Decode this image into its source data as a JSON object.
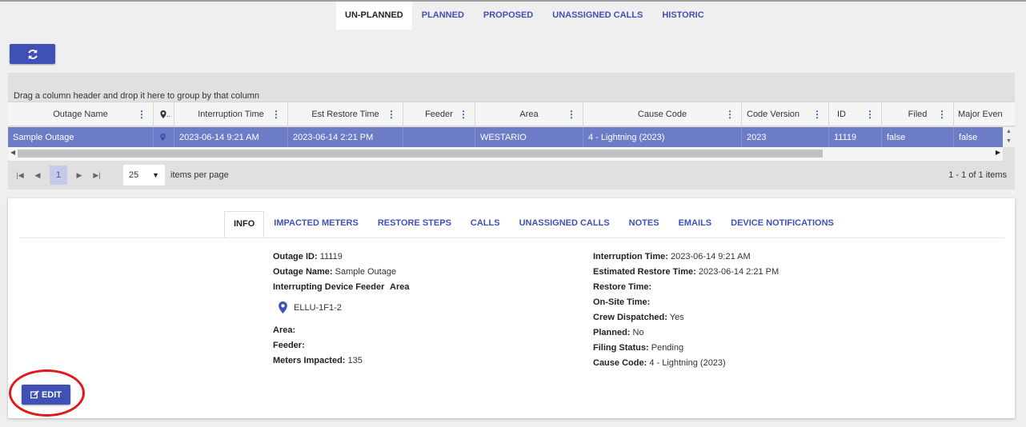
{
  "top_tabs": [
    "UN-PLANNED",
    "PLANNED",
    "PROPOSED",
    "UNASSIGNED CALLS",
    "HISTORIC"
  ],
  "grid": {
    "group_hint": "Drag a column header and drop it here to group by that column",
    "columns": [
      "Outage Name",
      "",
      "Interruption Time",
      "Est Restore Time",
      "Feeder",
      "Area",
      "Cause Code",
      "Code Version",
      "ID",
      "Filed",
      "Major Even"
    ],
    "location_col_suffix": "..",
    "row": {
      "outage_name": "Sample Outage",
      "interruption_time": "2023-06-14 9:21 AM",
      "est_restore_time": "2023-06-14 2:21 PM",
      "feeder": "",
      "area": "WESTARIO",
      "cause_code": "4 - Lightning (2023)",
      "code_version": "2023",
      "id": "11119",
      "filed": "false",
      "major_event": "false"
    }
  },
  "pager": {
    "current_page": "1",
    "page_size": "25",
    "items_label": "items per page",
    "info": "1 - 1 of 1 items"
  },
  "detail_tabs": [
    "INFO",
    "IMPACTED METERS",
    "RESTORE STEPS",
    "CALLS",
    "UNASSIGNED CALLS",
    "NOTES",
    "EMAILS",
    "DEVICE NOTIFICATIONS"
  ],
  "info_left": {
    "outage_id_label": "Outage ID:",
    "outage_id": "11119",
    "outage_name_label": "Outage Name:",
    "outage_name": "Sample Outage",
    "device_feeder_label": "Interrupting Device Feeder",
    "area_header": "Area",
    "device": "ELLU-1F1-2",
    "area_label": "Area:",
    "area": "",
    "feeder_label": "Feeder:",
    "feeder": "",
    "meters_label": "Meters Impacted:",
    "meters": "135"
  },
  "info_right": {
    "interruption_label": "Interruption Time:",
    "interruption": "2023-06-14 9:21 AM",
    "est_restore_label": "Estimated Restore Time:",
    "est_restore": "2023-06-14 2:21 PM",
    "restore_label": "Restore Time:",
    "restore": "",
    "onsite_label": "On-Site Time:",
    "onsite": "",
    "crew_label": "Crew Dispatched:",
    "crew": "Yes",
    "planned_label": "Planned:",
    "planned": "No",
    "filing_label": "Filing Status:",
    "filing": "Pending",
    "cause_label": "Cause Code:",
    "cause": "4 - Lightning (2023)"
  },
  "edit_label": "EDIT",
  "colors": {
    "primary": "#3f51b5",
    "selected_row": "#6c7cc7",
    "annotation": "#e01a1a"
  }
}
